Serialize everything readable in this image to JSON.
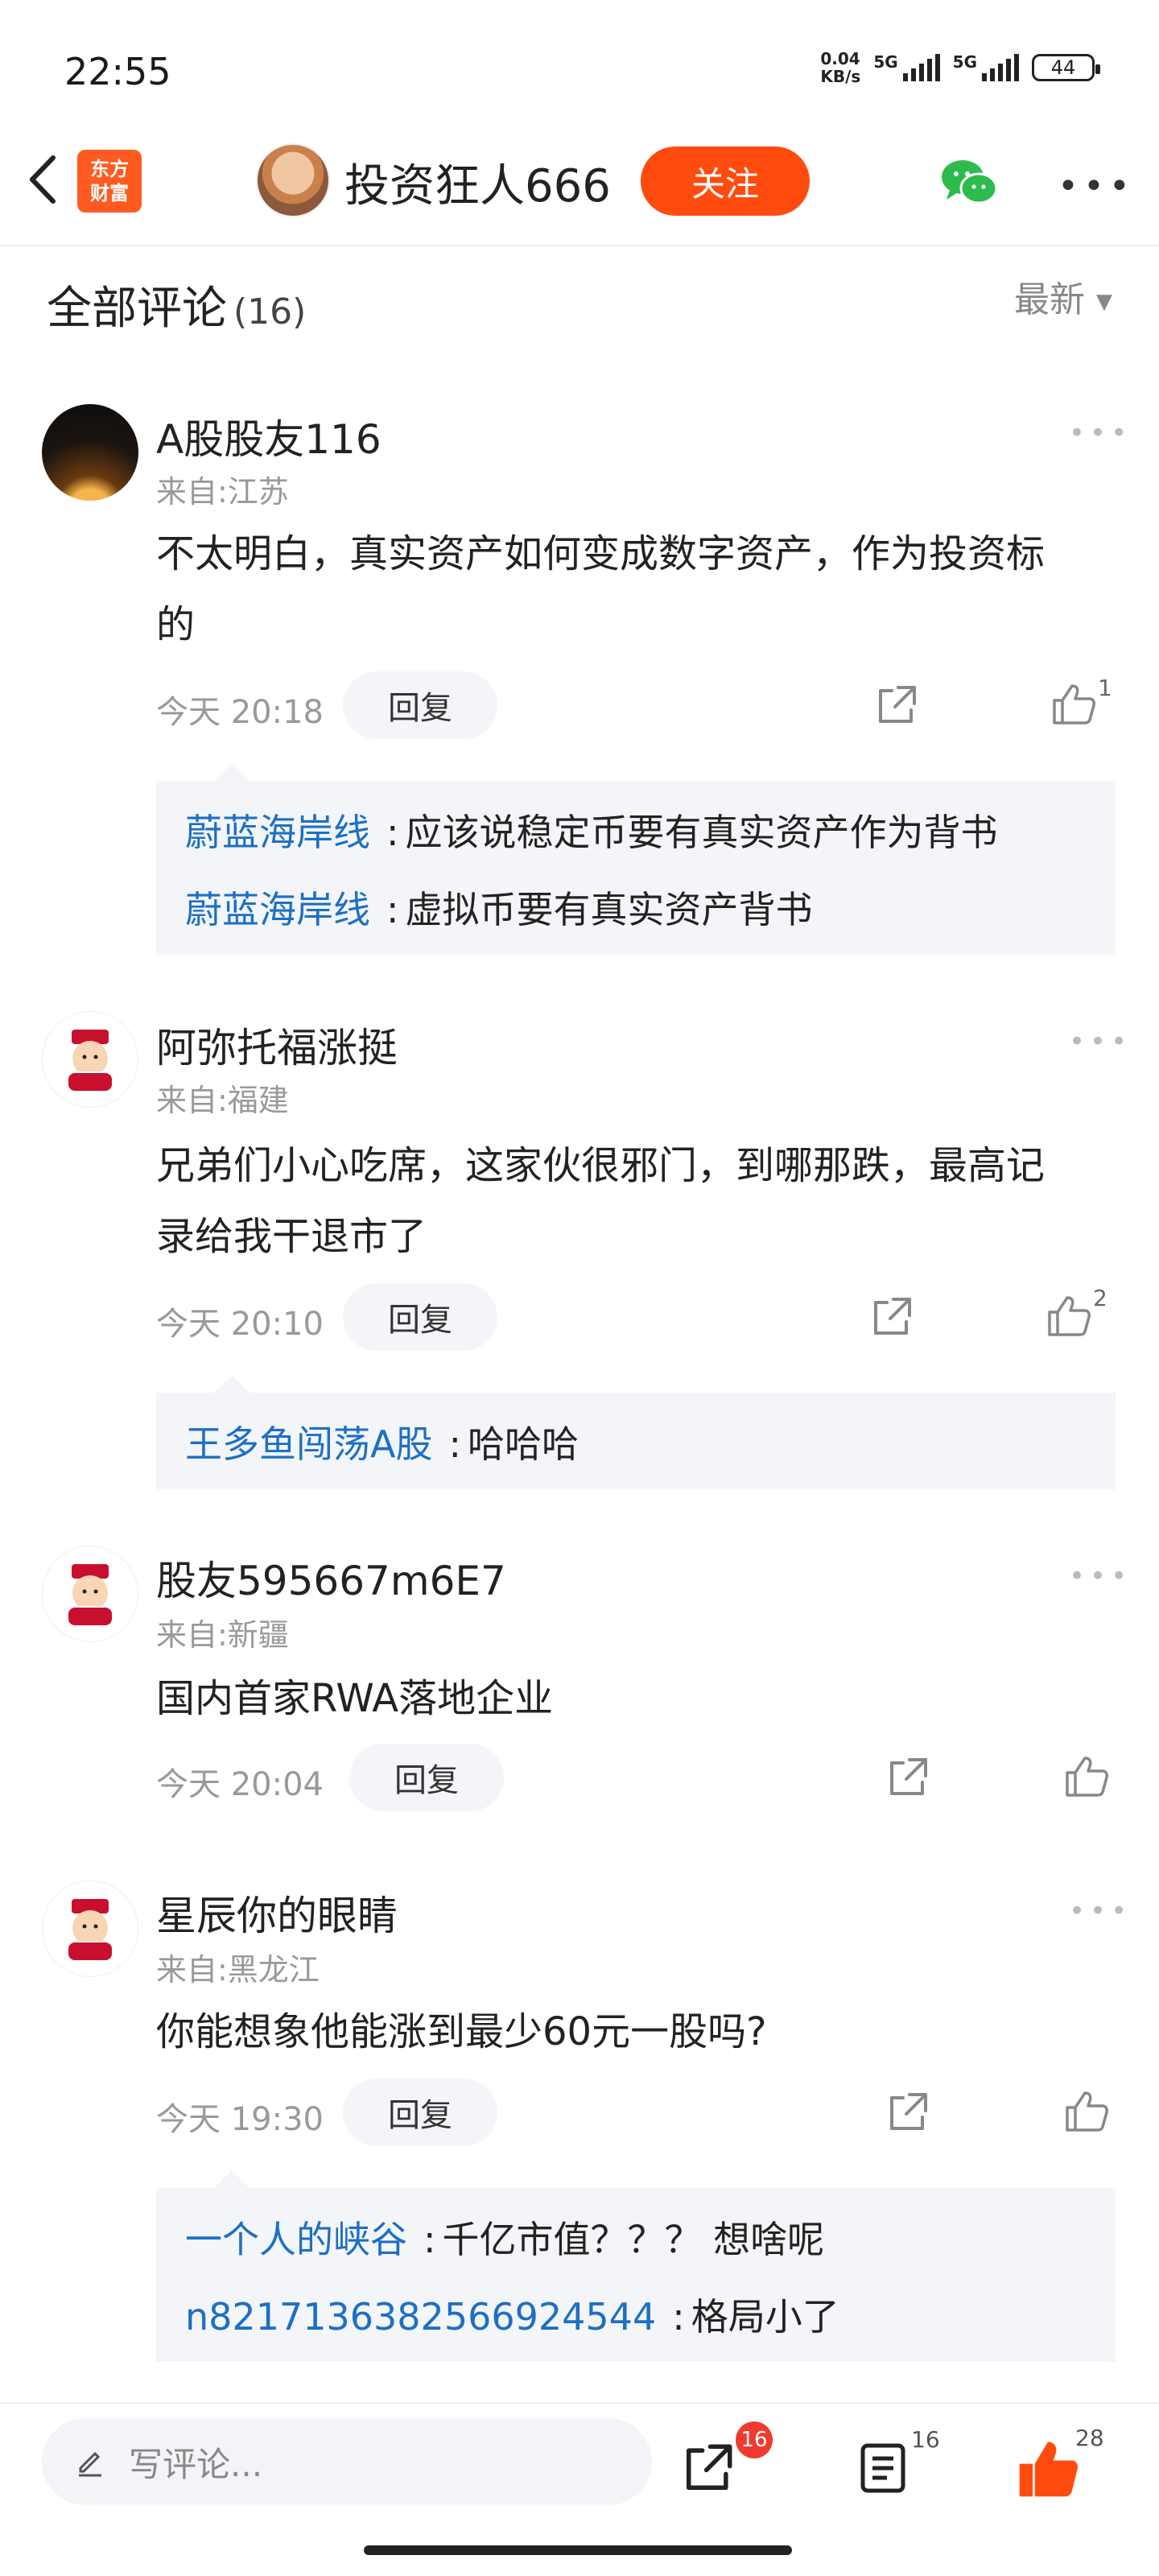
{
  "status": {
    "time": "22:55",
    "speed_value": "0.04",
    "speed_unit": "KB/s",
    "net1": "5G",
    "net2": "5G",
    "battery": "44"
  },
  "header": {
    "logo_line1": "东方",
    "logo_line2": "财富",
    "username": "投资狂人666",
    "follow": "关注"
  },
  "comments_header": {
    "title": "全部评论",
    "count": "(16)",
    "sort": "最新"
  },
  "comments": [
    {
      "user": "A股股友116",
      "from": "来自:江苏",
      "text_line1": "不太明白，真实资产如何变成数字资产，作为投资标",
      "text_line2": "的",
      "time": "今天 20:18",
      "reply": "回复",
      "likes": "1",
      "replies": [
        {
          "name": "蔚蓝海岸线",
          "sep": ":",
          "text": "应该说稳定币要有真实资产作为背书"
        },
        {
          "name": "蔚蓝海岸线",
          "sep": ":",
          "text": "虚拟币要有真实资产背书"
        }
      ]
    },
    {
      "user": "阿弥托福涨挺",
      "from": "来自:福建",
      "text_line1": "兄弟们小心吃席，这家伙很邪门，到哪那跌，最高记",
      "text_line2": "录给我干退市了",
      "time": "今天 20:10",
      "reply": "回复",
      "likes": "2",
      "replies": [
        {
          "name": "王多鱼闯荡A股",
          "sep": ":",
          "text": "哈哈哈"
        }
      ]
    },
    {
      "user": "股友595667m6E7",
      "from": "来自:新疆",
      "text_line1": "国内首家RWA落地企业",
      "time": "今天 20:04",
      "reply": "回复",
      "likes": ""
    },
    {
      "user": "星辰你的眼睛",
      "from": "来自:黑龙江",
      "text_line1": "你能想象他能涨到最少60元一股吗?",
      "time": "今天 19:30",
      "reply": "回复",
      "likes": "",
      "replies": [
        {
          "name": "一个人的峡谷",
          "sep": ":",
          "text": "千亿市值？？？ 想啥呢"
        },
        {
          "name": "n8217136382566924544",
          "sep": ":",
          "text": "格局小了"
        }
      ]
    }
  ],
  "bottom": {
    "placeholder": "写评论...",
    "share_count": "16",
    "comment_count": "16",
    "like_count": "28"
  },
  "colors": {
    "accent": "#ff4c0e",
    "link": "#1d6fc4",
    "badge": "#f03a2e"
  }
}
